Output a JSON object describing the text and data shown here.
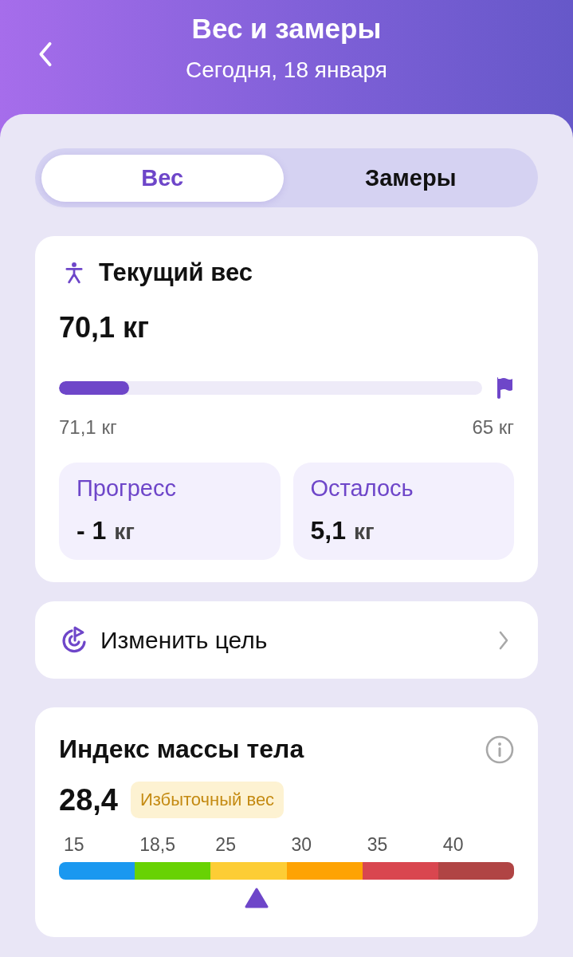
{
  "header": {
    "title": "Вес и замеры",
    "subtitle": "Сегодня, 18 января"
  },
  "tabs": [
    {
      "label": "Вес",
      "selected": true
    },
    {
      "label": "Замеры",
      "selected": false
    }
  ],
  "current_weight": {
    "title": "Текущий вес",
    "value": "70,1 кг",
    "progress": {
      "level": 0.165,
      "start": "71,1 кг",
      "goal": "65 кг"
    },
    "stats": [
      {
        "label": "Прогресс",
        "value": "- 1",
        "unit": "кг"
      },
      {
        "label": "Осталось",
        "value": "5,1",
        "unit": "кг"
      }
    ]
  },
  "goal_row": {
    "label": "Изменить цель"
  },
  "bmi": {
    "title": "Индекс массы тела",
    "value": "28,4",
    "category": "Избыточный вес",
    "scale": [
      {
        "label": "15",
        "color": "#1a98f0"
      },
      {
        "label": "18,5",
        "color": "#68d203"
      },
      {
        "label": "25",
        "color": "#fdcd35"
      },
      {
        "label": "30",
        "color": "#fea303"
      },
      {
        "label": "35",
        "color": "#d9464f"
      },
      {
        "label": "40",
        "color": "#b04444"
      }
    ]
  }
}
